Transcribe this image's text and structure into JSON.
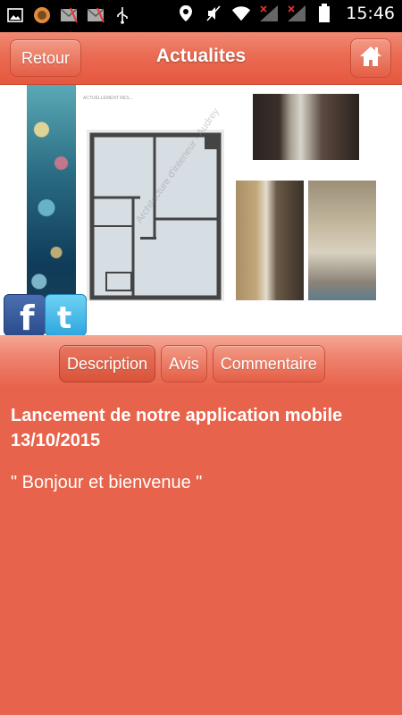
{
  "status_bar": {
    "time": "15:46",
    "icons_left": [
      "image-icon",
      "app-icon",
      "mail-icon",
      "mail-icon",
      "usb-icon"
    ],
    "icons_right": [
      "location-icon",
      "mute-icon",
      "wifi-icon",
      "signal-icon",
      "signal-icon",
      "battery-icon"
    ]
  },
  "header": {
    "back_label": "Retour",
    "title": "Actualites",
    "home_icon": "home-icon"
  },
  "hero": {
    "plan_caption": "ACTUELLEMENT RES...",
    "watermark": "Architecture d'interieur - Audrey"
  },
  "social": {
    "facebook_glyph": "f",
    "twitter_glyph": "t"
  },
  "tabs": [
    {
      "label": "Description",
      "active": true
    },
    {
      "label": "Avis",
      "active": false
    },
    {
      "label": "Commentaire",
      "active": false
    }
  ],
  "article": {
    "headline": "Lancement de notre application mobile 13/10/2015",
    "body": "\" Bonjour et bienvenue \""
  },
  "colors": {
    "accent": "#e8634b",
    "header": "#ea6b52"
  }
}
